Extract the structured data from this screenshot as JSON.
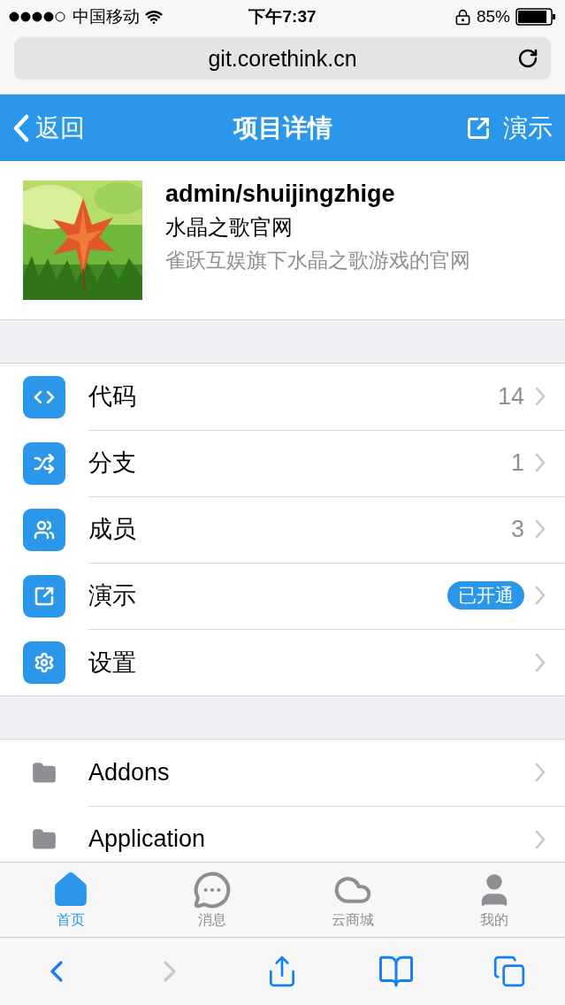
{
  "status_bar": {
    "carrier": "中国移动",
    "time": "下午7:37",
    "battery": "85%"
  },
  "url_bar": {
    "url": "git.corethink.cn"
  },
  "nav_bar": {
    "back": "返回",
    "title": "项目详情",
    "action": "演示"
  },
  "project": {
    "name": "admin/shuijingzhige",
    "title": "水晶之歌官网",
    "description": "雀跃互娱旗下水晶之歌游戏的官网"
  },
  "menu": [
    {
      "label": "代码",
      "kind": "count",
      "value": "14"
    },
    {
      "label": "分支",
      "kind": "count",
      "value": "1"
    },
    {
      "label": "成员",
      "kind": "count",
      "value": "3"
    },
    {
      "label": "演示",
      "kind": "badge",
      "value": "已开通"
    },
    {
      "label": "设置",
      "kind": "plain"
    }
  ],
  "folders": [
    {
      "name": "Addons"
    },
    {
      "name": "Application"
    }
  ],
  "tab_bar": [
    {
      "label": "首页",
      "selected": true
    },
    {
      "label": "消息",
      "selected": false
    },
    {
      "label": "云商城",
      "selected": false
    },
    {
      "label": "我的",
      "selected": false
    }
  ],
  "browser_toolbar": {
    "back_disabled": false,
    "forward_disabled": true
  }
}
